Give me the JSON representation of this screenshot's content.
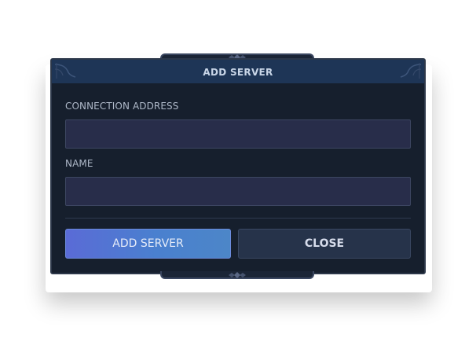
{
  "dialog": {
    "title": "ADD SERVER",
    "connection_address_label": "CONNECTION ADDRESS",
    "connection_address_value": "",
    "name_label": "NAME",
    "name_value": "",
    "add_server_button": "ADD SERVER",
    "close_button": "CLOSE"
  },
  "colors": {
    "dialog_background": "#161f2d",
    "titlebar": "#1e3556",
    "input_background": "#282d4a",
    "primary_button_start": "#5a6bd6",
    "primary_button_end": "#4c86c8",
    "secondary_button": "#26334a"
  },
  "icons": {
    "top_ornament": "diamond-ornament-icon",
    "bottom_ornament": "diamond-ornament-icon",
    "corner_decoration": "corner-flourish-icon"
  }
}
